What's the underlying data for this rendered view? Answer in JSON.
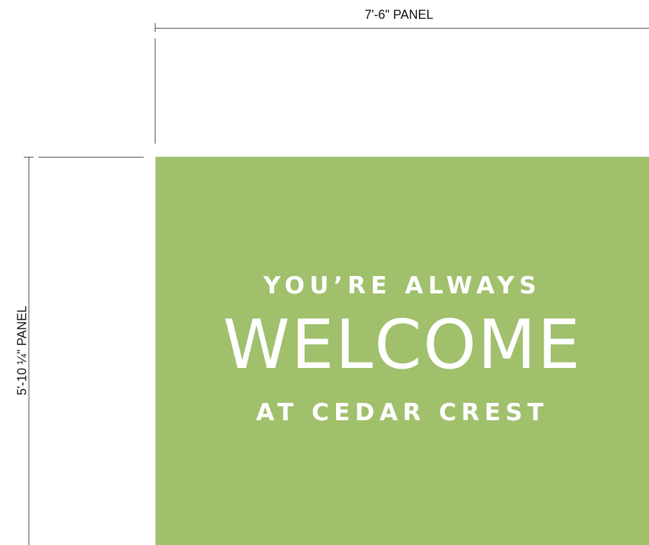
{
  "dimensions": {
    "width_label": "7'-6\" PANEL",
    "height_label": "5'-10 ¼\" PANEL"
  },
  "panel": {
    "background_color": "#a0c06c",
    "text_color": "#ffffff",
    "line1": "YOU’RE ALWAYS",
    "line2": "WELCOME",
    "line3": "AT CEDAR CREST"
  }
}
